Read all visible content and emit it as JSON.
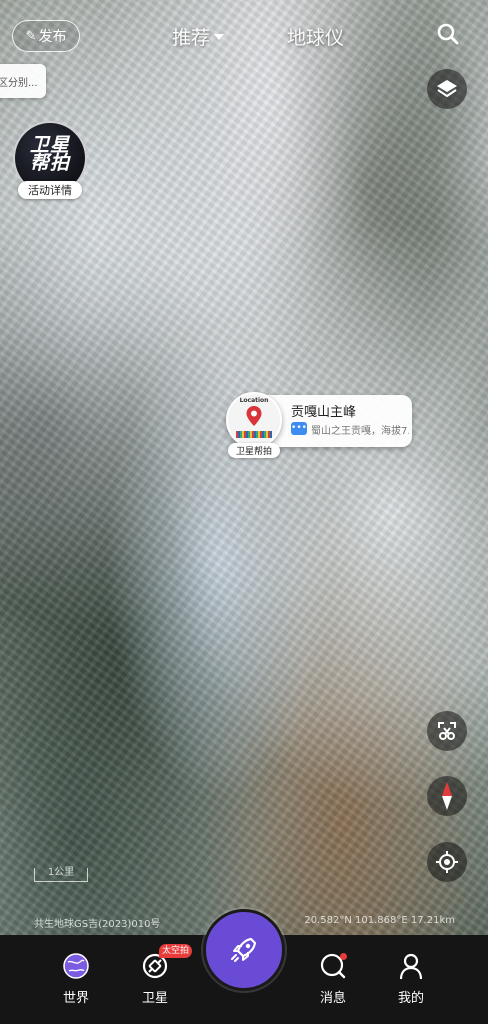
{
  "header": {
    "publish_label": "发布",
    "tabs": [
      {
        "label": "推荐",
        "selected": true
      },
      {
        "label": "地球仪",
        "selected": false
      }
    ],
    "notice_text": "区分别..."
  },
  "promo": {
    "badge_line1": "卫星",
    "badge_line2": "帮拍",
    "caption": "活动详情"
  },
  "poi": {
    "pin_label": "Location",
    "caption": "卫星帮拍",
    "title": "贡嘎山主峰",
    "description": "蜀山之王贡嘎，海拔7..."
  },
  "map_info": {
    "scale": "1公里",
    "copyright": "共生地球GS吉(2023)010号",
    "coordinates": "20.582°N 101.868°E 17.21km"
  },
  "bottom_nav": {
    "items": [
      {
        "label": "世界",
        "icon": "globe-icon"
      },
      {
        "label": "卫星",
        "icon": "satellite-icon",
        "badge": "太空拍"
      },
      {
        "label": "消息",
        "icon": "message-icon",
        "has_dot": true
      },
      {
        "label": "我的",
        "icon": "profile-icon"
      }
    ],
    "center_icon": "rocket-icon"
  },
  "colors": {
    "accent": "#6a4bd6",
    "badge_red": "#e83b3b",
    "info_blue": "#3d8cf0",
    "nav_bg": "#151515"
  }
}
